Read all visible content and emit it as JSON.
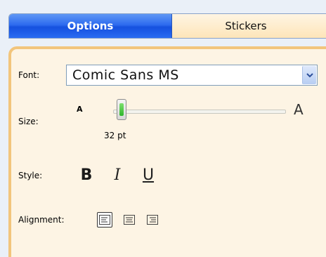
{
  "tabs": [
    {
      "label": "Options",
      "active": true
    },
    {
      "label": "Stickers",
      "active": false
    }
  ],
  "options": {
    "font_label": "Font:",
    "font_value": "Comic Sans MS",
    "size_label": "Size:",
    "size_small_glyph": "A",
    "size_large_glyph": "A",
    "size_value": "32 pt",
    "size_fraction": 0.05,
    "style_label": "Style:",
    "bold_glyph": "B",
    "italic_glyph": "I",
    "underline_glyph": "U",
    "alignment_label": "Alignment:",
    "alignment_selected": "left"
  },
  "colors": {
    "active_tab": "#2d6bef",
    "inactive_tab": "#fde9c4",
    "panel_background": "#fdf4e4",
    "panel_border": "#f2c57c",
    "slider_grip": "#2fb52b"
  },
  "icons": {
    "select_arrow": "chevron-down-icon",
    "align_left": "align-left-icon",
    "align_center": "align-center-icon",
    "align_right": "align-right-icon"
  }
}
